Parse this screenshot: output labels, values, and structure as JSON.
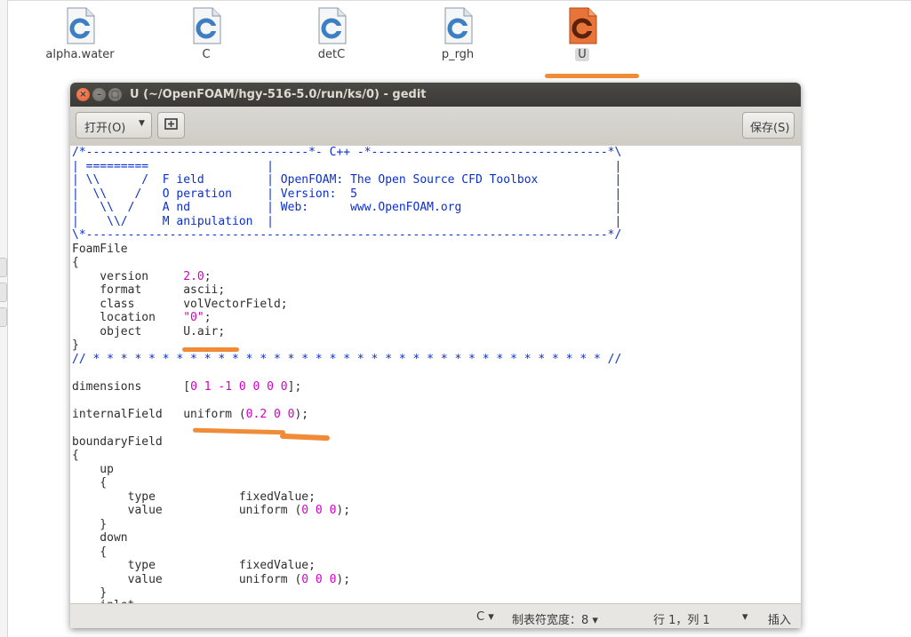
{
  "desktop": {
    "files": [
      {
        "name": "alpha.water",
        "selected": false
      },
      {
        "name": "C",
        "selected": false
      },
      {
        "name": "detC",
        "selected": false
      },
      {
        "name": "p_rgh",
        "selected": false
      },
      {
        "name": "U",
        "selected": true
      }
    ]
  },
  "window": {
    "title": "U (~/OpenFOAM/hgy-516-5.0/run/ks/0) - gedit",
    "close_glyph": "×",
    "min_glyph": "–",
    "max_glyph": "□"
  },
  "toolbar": {
    "open_label": "打开(O)",
    "open_arrow": "▼",
    "new_doc_icon": "new-document-icon",
    "save_label": "保存(S)"
  },
  "editor": {
    "lines": [
      "/*--------------------------------*- C++ -*----------------------------------*\\",
      "| =========                 |                                                 |",
      "| \\\\      /  F ield         | OpenFOAM: The Open Source CFD Toolbox           |",
      "|  \\\\    /   O peration     | Version:  5                                     |",
      "|   \\\\  /    A nd           | Web:      www.OpenFOAM.org                      |",
      "|    \\\\/     M anipulation  |                                                 |",
      "\\*---------------------------------------------------------------------------*/",
      "FoamFile",
      "{",
      "    version     2.0;",
      "    format      ascii;",
      "    class       volVectorField;",
      "    location    \"0\";",
      "    object      U.air;",
      "}",
      "// * * * * * * * * * * * * * * * * * * * * * * * * * * * * * * * * * * * * * //",
      "",
      "dimensions      [0 1 -1 0 0 0 0];",
      "",
      "internalField   uniform (0.2 0 0);",
      "",
      "boundaryField",
      "{",
      "    up",
      "    {",
      "        type            fixedValue;",
      "        value           uniform (0 0 0);",
      "    }",
      "    down",
      "    {",
      "        type            fixedValue;",
      "        value           uniform (0 0 0);",
      "    }",
      "    inlet"
    ]
  },
  "statusbar": {
    "language": "C ▾",
    "tab_width": "制表符宽度：8 ▾",
    "position": "行 1，列 1",
    "mode_arrow": "▾",
    "insert_mode": "插入"
  },
  "colors": {
    "comment": "#0a2fd0",
    "number_string": "#d400c6",
    "annotation": "#f08b38",
    "icon_blue": "#3d7fc1",
    "icon_orange": "#e05d1c"
  }
}
